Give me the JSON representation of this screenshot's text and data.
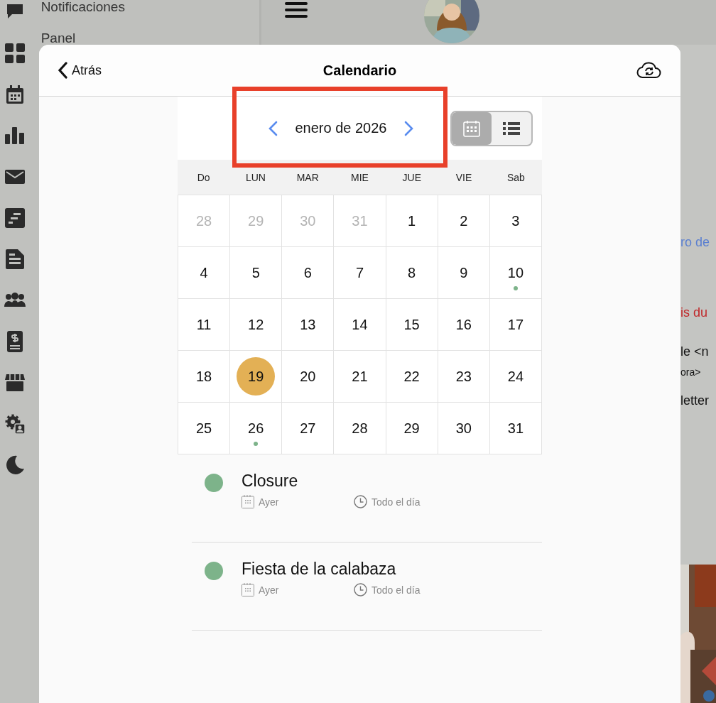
{
  "sidebar": {
    "icons": [
      {
        "kind": "chat"
      },
      {
        "kind": "grid"
      },
      {
        "kind": "calendar"
      },
      {
        "kind": "chart"
      },
      {
        "kind": "mail"
      },
      {
        "kind": "notes"
      },
      {
        "kind": "document"
      },
      {
        "kind": "group"
      },
      {
        "kind": "invoice"
      },
      {
        "kind": "store"
      },
      {
        "kind": "settings"
      },
      {
        "kind": "moon"
      }
    ]
  },
  "menu": {
    "items": [
      "Notificaciones",
      "Panel"
    ]
  },
  "background_texts": [
    {
      "text": "ro de",
      "kind": "link"
    },
    {
      "text": "is du",
      "kind": "warning"
    },
    {
      "text": "le <n",
      "kind": "normal"
    },
    {
      "text": "ora>",
      "kind": "small"
    },
    {
      "text": "letter",
      "kind": "normal"
    }
  ],
  "modal": {
    "back": "Atrás",
    "title": "Calendario",
    "month": "enero de 2026",
    "annotation": {
      "kind": "rectangle"
    },
    "view_toggle": [
      {
        "kind": "calendar",
        "selected": true
      },
      {
        "kind": "list",
        "selected": false
      }
    ],
    "weekdays": [
      "Do",
      "LUN",
      "MAR",
      "MIE",
      "JUE",
      "VIE",
      "Sab"
    ],
    "weeks": [
      [
        {
          "label": "28",
          "outside": true,
          "selected": false,
          "event": false
        },
        {
          "label": "29",
          "outside": true,
          "selected": false,
          "event": false
        },
        {
          "label": "30",
          "outside": true,
          "selected": false,
          "event": false
        },
        {
          "label": "31",
          "outside": true,
          "selected": false,
          "event": false
        },
        {
          "label": "1",
          "outside": false,
          "selected": false,
          "event": false
        },
        {
          "label": "2",
          "outside": false,
          "selected": false,
          "event": false
        },
        {
          "label": "3",
          "outside": false,
          "selected": false,
          "event": false
        }
      ],
      [
        {
          "label": "4",
          "outside": false,
          "selected": false,
          "event": false
        },
        {
          "label": "5",
          "outside": false,
          "selected": false,
          "event": false
        },
        {
          "label": "6",
          "outside": false,
          "selected": false,
          "event": false
        },
        {
          "label": "7",
          "outside": false,
          "selected": false,
          "event": false
        },
        {
          "label": "8",
          "outside": false,
          "selected": false,
          "event": false
        },
        {
          "label": "9",
          "outside": false,
          "selected": false,
          "event": false
        },
        {
          "label": "10",
          "outside": false,
          "selected": false,
          "event": true
        }
      ],
      [
        {
          "label": "11",
          "outside": false,
          "selected": false,
          "event": false
        },
        {
          "label": "12",
          "outside": false,
          "selected": false,
          "event": false
        },
        {
          "label": "13",
          "outside": false,
          "selected": false,
          "event": false
        },
        {
          "label": "14",
          "outside": false,
          "selected": false,
          "event": false
        },
        {
          "label": "15",
          "outside": false,
          "selected": false,
          "event": false
        },
        {
          "label": "16",
          "outside": false,
          "selected": false,
          "event": false
        },
        {
          "label": "17",
          "outside": false,
          "selected": false,
          "event": false
        }
      ],
      [
        {
          "label": "18",
          "outside": false,
          "selected": false,
          "event": false
        },
        {
          "label": "19",
          "outside": false,
          "selected": true,
          "event": false
        },
        {
          "label": "20",
          "outside": false,
          "selected": false,
          "event": false
        },
        {
          "label": "21",
          "outside": false,
          "selected": false,
          "event": false
        },
        {
          "label": "22",
          "outside": false,
          "selected": false,
          "event": false
        },
        {
          "label": "23",
          "outside": false,
          "selected": false,
          "event": false
        },
        {
          "label": "24",
          "outside": false,
          "selected": false,
          "event": false
        }
      ],
      [
        {
          "label": "25",
          "outside": false,
          "selected": false,
          "event": false
        },
        {
          "label": "26",
          "outside": false,
          "selected": false,
          "event": true
        },
        {
          "label": "27",
          "outside": false,
          "selected": false,
          "event": false
        },
        {
          "label": "28",
          "outside": false,
          "selected": false,
          "event": false
        },
        {
          "label": "29",
          "outside": false,
          "selected": false,
          "event": false
        },
        {
          "label": "30",
          "outside": false,
          "selected": false,
          "event": false
        },
        {
          "label": "31",
          "outside": false,
          "selected": false,
          "event": false
        }
      ]
    ],
    "events": [
      {
        "title": "Closure",
        "color": "#7db38a",
        "date": "Ayer",
        "time": "Todo el día"
      },
      {
        "title": "Fiesta de la calabaza",
        "color": "#7db38a",
        "date": "Ayer",
        "time": "Todo el día"
      }
    ]
  }
}
